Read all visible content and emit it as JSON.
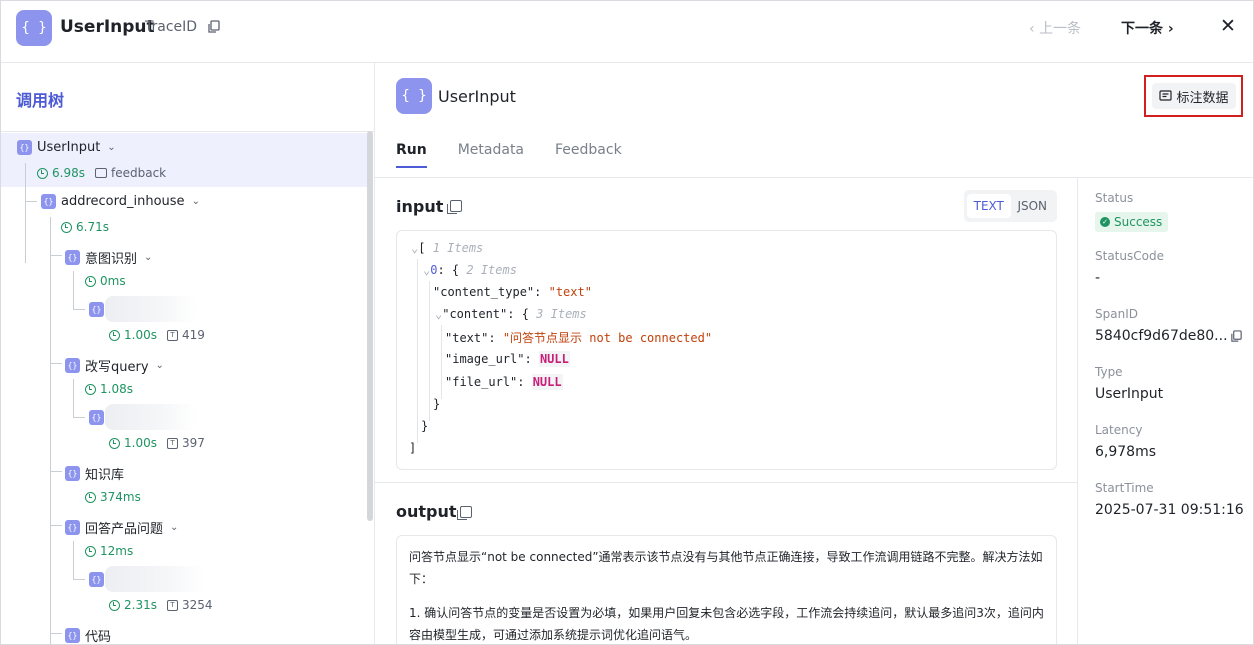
{
  "header": {
    "icon": "braces-icon",
    "title": "UserInput",
    "trace_label": "TraceID",
    "prev_label": "上一条",
    "next_label": "下一条"
  },
  "tree": {
    "title": "调用树",
    "nodes": [
      {
        "label": "UserInput",
        "latency": "6.98s",
        "extra": "feedback"
      },
      {
        "label": "addrecord_inhouse",
        "latency": "6.71s"
      },
      {
        "label": "意图识别",
        "latency": "0ms"
      },
      {
        "label": "",
        "latency": "1.00s",
        "tokens": "419"
      },
      {
        "label": "改写query",
        "latency": "1.08s"
      },
      {
        "label": "",
        "latency": "1.00s",
        "tokens": "397"
      },
      {
        "label": "知识库",
        "latency": "374ms"
      },
      {
        "label": "回答产品问题",
        "latency": "12ms"
      },
      {
        "label": "",
        "latency": "2.31s",
        "tokens": "3254"
      },
      {
        "label": "代码"
      }
    ]
  },
  "main": {
    "title": "UserInput",
    "annotate_label": "标注数据",
    "tabs": [
      "Run",
      "Metadata",
      "Feedback"
    ],
    "input_title": "input",
    "view_text": "TEXT",
    "view_json": "JSON",
    "code": {
      "open": "[",
      "items1": "1 Items",
      "idx": "0",
      "items2": "2 Items",
      "k_content_type": "\"content_type\"",
      "v_content_type": "\"text\"",
      "k_content": "\"content\"",
      "items3": "3 Items",
      "k_text": "\"text\"",
      "v_text": "\"问答节点显示 not be connected\"",
      "k_image_url": "\"image_url\"",
      "k_file_url": "\"file_url\"",
      "null": "NULL"
    },
    "output_title": "output",
    "output_p1": "问答节点显示“not be connected”通常表示该节点没有与其他节点正确连接，导致工作流调用链路不完整。解决方法如下：",
    "output_p2": "1. 确认问答节点的变量是否设置为必填，如果用户回复未包含必选字段，工作流会持续追问，默认最多追问3次，追问内容由模型生成，可通过添加系统提示词优化追问语气。"
  },
  "info": {
    "status_label": "Status",
    "status_value": "Success",
    "statuscode_label": "StatusCode",
    "statuscode_value": "-",
    "spanid_label": "SpanID",
    "spanid_value": "5840cf9d67de80...",
    "type_label": "Type",
    "type_value": "UserInput",
    "latency_label": "Latency",
    "latency_value": "6,978ms",
    "starttime_label": "StartTime",
    "starttime_value": "2025-07-31 09:51:16"
  },
  "colors": {
    "accent": "#4e5bd6",
    "success": "#1f9460",
    "highlight_border": "#d21f1f"
  }
}
